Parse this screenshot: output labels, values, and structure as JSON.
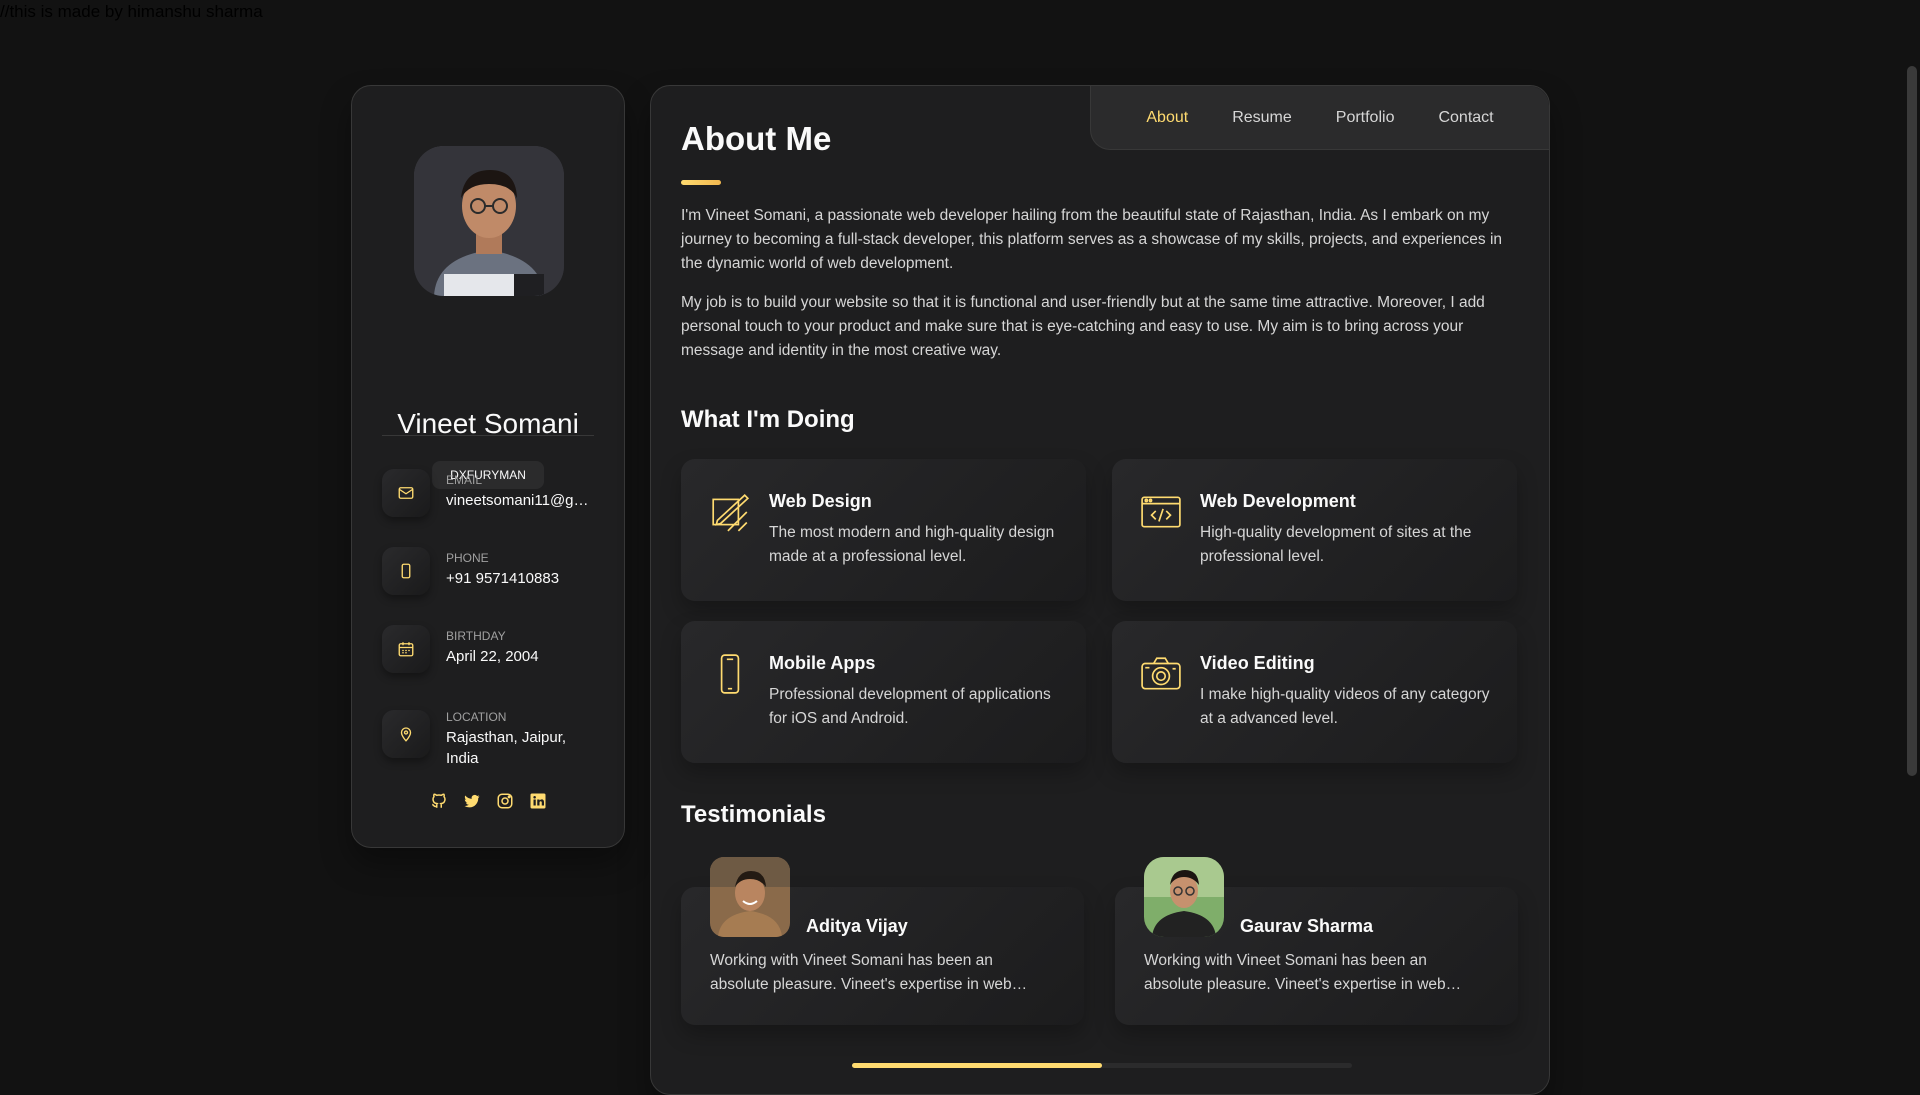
{
  "page_note": "//this is made by himanshu sharma",
  "profile": {
    "name": "Vineet Somani",
    "title": "DXFURYMAN"
  },
  "contacts": [
    {
      "label": "EMAIL",
      "value": "vineetsomani11@gm...",
      "icon": "mail-icon"
    },
    {
      "label": "PHONE",
      "value": "+91 9571410883",
      "icon": "phone-icon"
    },
    {
      "label": "BIRTHDAY",
      "value": "April 22, 2004",
      "icon": "calendar-icon"
    },
    {
      "label": "LOCATION",
      "value": "Rajasthan, Jaipur, India",
      "icon": "location-pin-icon"
    }
  ],
  "socials": [
    "github-icon",
    "twitter-icon",
    "instagram-icon",
    "linkedin-icon"
  ],
  "nav": {
    "items": [
      "About",
      "Resume",
      "Portfolio",
      "Contact"
    ],
    "active": "About"
  },
  "about": {
    "title": "About Me",
    "paragraphs": [
      "I'm Vineet Somani, a passionate web developer hailing from the beautiful state of Rajasthan, India. As I embark on my journey to becoming a full-stack developer, this platform serves as a showcase of my skills, projects, and experiences in the dynamic world of web development.",
      "My job is to build your website so that it is functional and user-friendly but at the same time attractive. Moreover, I add personal touch to your product and make sure that is eye-catching and easy to use. My aim is to bring across your message and identity in the most creative way."
    ]
  },
  "services": {
    "title": "What I'm Doing",
    "items": [
      {
        "title": "Web Design",
        "text": "The most modern and high-quality design made at a professional level.",
        "icon": "design-icon"
      },
      {
        "title": "Web Development",
        "text": "High-quality development of sites at the professional level.",
        "icon": "code-icon"
      },
      {
        "title": "Mobile Apps",
        "text": "Professional development of applications for iOS and Android.",
        "icon": "mobile-icon"
      },
      {
        "title": "Video Editing",
        "text": "I make high-quality videos of any category at a advanced level.",
        "icon": "camera-icon"
      }
    ]
  },
  "testimonials": {
    "title": "Testimonials",
    "items": [
      {
        "name": "Aditya Vijay",
        "text": "Working with Vineet Somani has been an absolute pleasure. Vineet's expertise in web development is outstanding."
      },
      {
        "name": "Gaurav Sharma",
        "text": "Working with Vineet Somani has been an absolute pleasure. Vineet's expertise in web development is outstanding."
      }
    ],
    "scroll_progress": 0.5
  },
  "colors": {
    "accent": "#ffdb70",
    "background": "#121212",
    "card": "#1e1e1f"
  }
}
